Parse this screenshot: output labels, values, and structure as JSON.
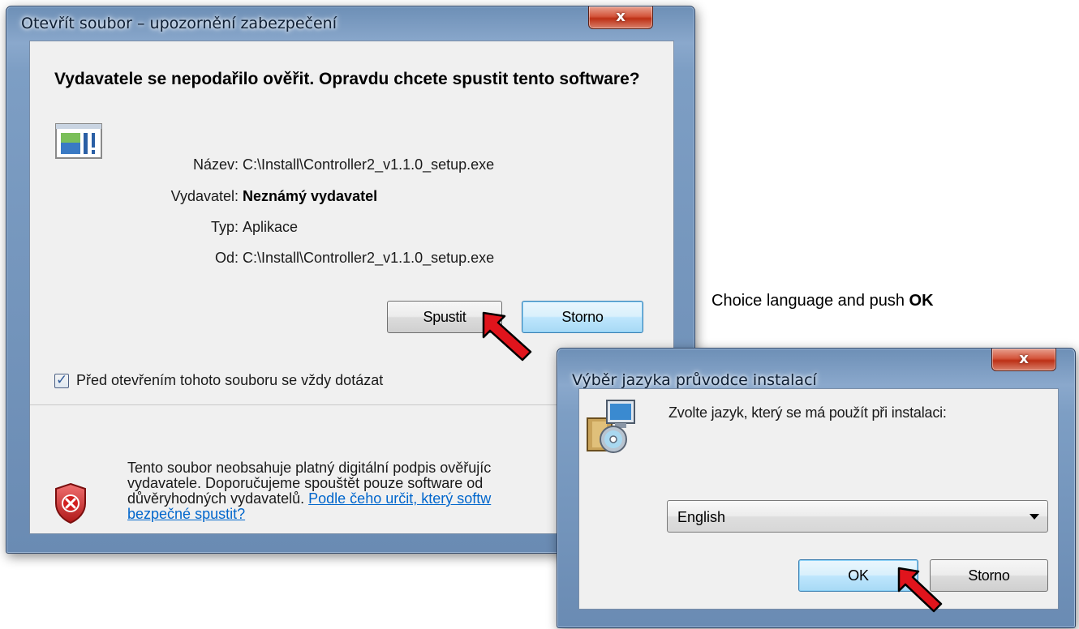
{
  "security_dialog": {
    "title": "Otevřít soubor – upozornění zabezpečení",
    "close_label": "x",
    "heading": "Vydavatele se nepodařilo ověřit. Opravdu chcete spustit tento software?",
    "app_icon": "application-file-icon",
    "fields": [
      {
        "label": "Název:",
        "value": "C:\\Install\\Controller2_v1.1.0_setup.exe"
      },
      {
        "label": "Vydavatel:",
        "value": "Neznámý vydavatel"
      },
      {
        "label": "Typ:",
        "value": "Aplikace"
      },
      {
        "label": "Od:",
        "value": "C:\\Install\\Controller2_v1.1.0_setup.exe"
      }
    ],
    "run_button": "Spustit",
    "cancel_button": "Storno",
    "checkbox_checked": true,
    "checkbox_label": "Před otevřením tohoto souboru se vždy dotázat",
    "warning_icon": "shield-error-icon",
    "warning_lines": [
      "Tento soubor neobsahuje platný digitální podpis ověřujíc",
      "vydavatele. Doporučujeme spouštět pouze software od",
      "důvěryhodných vydavatelů. "
    ],
    "warning_link_1": "Podle čeho určit, který softw",
    "warning_link_2": "bezpečné spustit?"
  },
  "caption": {
    "text": "Choice language and push ",
    "emphasis": "OK"
  },
  "language_dialog": {
    "title": "Výběr jazyka průvodce instalací",
    "close_label": "x",
    "setup_icon": "installer-icon",
    "prompt": "Zvolte jazyk, který se má použít při instalaci:",
    "selected_language": "English",
    "ok_button": "OK",
    "cancel_button": "Storno"
  },
  "colors": {
    "pointer_arrow": "#e0141c",
    "link": "#0066cc",
    "default_button_border": "#3c7fb1"
  }
}
